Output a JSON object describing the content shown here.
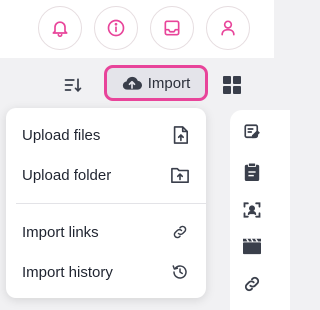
{
  "topbar": {
    "icons": [
      {
        "name": "bell-icon",
        "color": "#e8449a"
      },
      {
        "name": "info-icon",
        "color": "#e8449a"
      },
      {
        "name": "inbox-icon",
        "color": "#e8449a"
      },
      {
        "name": "user-icon",
        "color": "#e8449a"
      }
    ]
  },
  "toolbar": {
    "import_label": "Import",
    "import_icon": "cloud-upload-icon",
    "sort_icon": "sort-icon",
    "grid_icon": "grid-view-icon",
    "highlight_color": "#e8449a"
  },
  "import_menu": {
    "items": [
      {
        "label": "Upload files",
        "icon": "file-upload-icon"
      },
      {
        "label": "Upload folder",
        "icon": "folder-upload-icon"
      },
      {
        "label": "Import links",
        "icon": "link-icon"
      },
      {
        "label": "Import history",
        "icon": "history-icon"
      }
    ]
  },
  "side_panel": {
    "icons": [
      "edit-note-icon",
      "clipboard-icon",
      "face-scan-icon",
      "clapperboard-icon",
      "link-icon"
    ]
  }
}
